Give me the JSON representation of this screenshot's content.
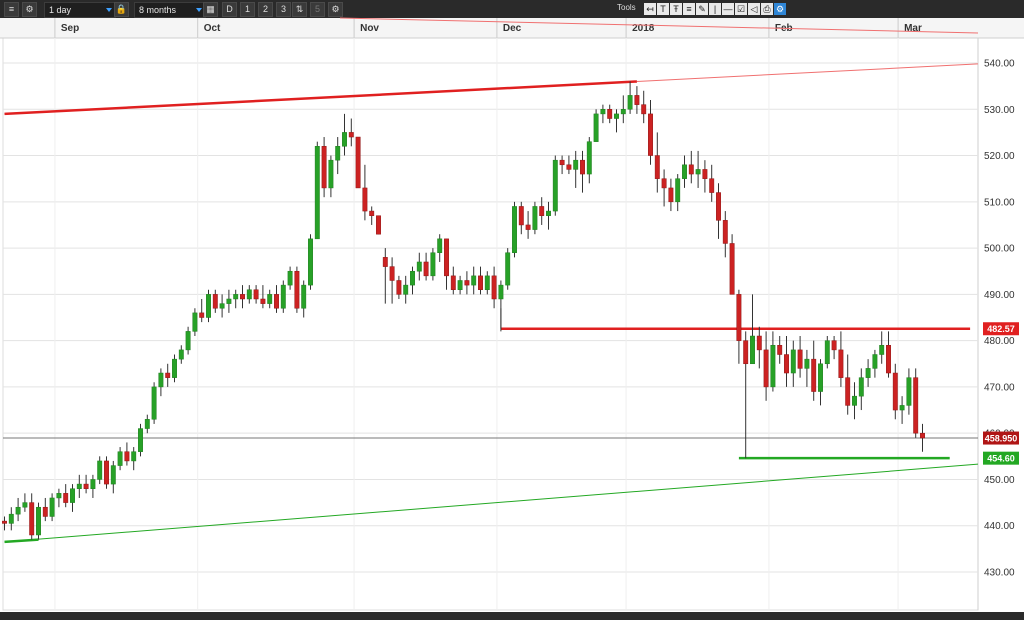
{
  "toolbar": {
    "interval": "1 day",
    "range": "8 months",
    "period_buttons": [
      "D",
      "1",
      "2",
      "3",
      "5"
    ],
    "tools_label": "Tools",
    "tool_icons": [
      "arrow-back-icon",
      "text-icon",
      "text-format-icon",
      "fibonacci-icon",
      "drawing-pen-icon",
      "vertical-line-icon",
      "horizontal-line-icon",
      "checkbox-icon",
      "shape-icon",
      "print-icon",
      "settings-icon"
    ]
  },
  "chart_data": {
    "type": "candlestick",
    "title": "",
    "xlabel": "",
    "ylabel": "",
    "ylim": [
      425,
      545
    ],
    "yticks": [
      "540.00",
      "530.00",
      "520.00",
      "510.00",
      "500.00",
      "490.00",
      "480.00",
      "470.00",
      "460.00",
      "450.00",
      "440.00",
      "430.00"
    ],
    "month_labels": [
      {
        "label": "Sep",
        "index": 8
      },
      {
        "label": "Oct",
        "index": 29
      },
      {
        "label": "Nov",
        "index": 52
      },
      {
        "label": "Dec",
        "index": 73
      },
      {
        "label": "2018",
        "index": 92
      },
      {
        "label": "Feb",
        "index": 113
      },
      {
        "label": "Mar",
        "index": 132
      }
    ],
    "candles": [
      [
        441,
        442,
        439,
        440.5
      ],
      [
        440.5,
        444,
        439,
        442.5
      ],
      [
        442.5,
        446,
        441,
        444
      ],
      [
        444,
        447,
        443,
        445
      ],
      [
        445,
        447,
        437,
        438
      ],
      [
        438,
        445,
        437,
        444
      ],
      [
        444,
        446,
        441,
        442
      ],
      [
        442,
        447,
        441,
        446
      ],
      [
        446,
        448,
        444,
        447
      ],
      [
        447,
        449,
        444,
        445
      ],
      [
        445,
        449,
        443,
        448
      ],
      [
        448,
        451,
        446,
        449
      ],
      [
        449,
        451,
        447,
        448
      ],
      [
        448,
        451,
        446,
        450
      ],
      [
        450,
        455,
        449,
        454
      ],
      [
        454,
        455,
        448,
        449
      ],
      [
        449,
        454,
        447,
        453
      ],
      [
        453,
        457,
        452,
        456
      ],
      [
        456,
        458,
        453,
        454
      ],
      [
        454,
        457,
        452,
        456
      ],
      [
        456,
        462,
        455,
        461
      ],
      [
        461,
        464,
        460,
        463
      ],
      [
        463,
        471,
        462,
        470
      ],
      [
        470,
        474,
        468,
        473
      ],
      [
        473,
        475,
        470,
        472
      ],
      [
        472,
        477,
        471,
        476
      ],
      [
        476,
        479,
        475,
        478
      ],
      [
        478,
        483,
        477,
        482
      ],
      [
        482,
        487,
        481,
        486
      ],
      [
        486,
        489,
        484,
        485
      ],
      [
        485,
        491,
        484,
        490
      ],
      [
        490,
        491,
        486,
        487
      ],
      [
        487,
        490,
        485,
        488
      ],
      [
        488,
        491,
        486,
        489
      ],
      [
        489,
        491,
        487,
        490
      ],
      [
        490,
        492,
        487,
        489
      ],
      [
        489,
        492,
        488,
        491
      ],
      [
        491,
        492,
        488,
        489
      ],
      [
        489,
        492,
        487,
        488
      ],
      [
        488,
        491,
        487,
        490
      ],
      [
        490,
        492,
        486,
        487
      ],
      [
        487,
        493,
        486,
        492
      ],
      [
        492,
        496,
        491,
        495
      ],
      [
        495,
        496,
        486,
        487
      ],
      [
        487,
        493,
        485,
        492
      ],
      [
        492,
        503,
        491,
        502
      ],
      [
        502,
        523,
        509,
        522
      ],
      [
        522,
        524,
        511,
        513
      ],
      [
        513,
        520,
        511,
        519
      ],
      [
        519,
        524,
        516,
        522
      ],
      [
        522,
        529,
        520,
        525
      ],
      [
        525,
        528,
        522,
        524
      ],
      [
        524,
        520,
        514,
        513
      ],
      [
        513,
        518,
        506,
        508
      ],
      [
        508,
        509,
        505,
        507
      ],
      [
        507,
        504,
        503,
        503
      ],
      [
        498,
        500,
        488,
        496
      ],
      [
        496,
        498,
        488,
        493
      ],
      [
        493,
        494,
        489,
        490
      ],
      [
        490,
        494,
        488,
        492
      ],
      [
        492,
        496,
        490,
        495
      ],
      [
        495,
        499,
        493,
        497
      ],
      [
        497,
        499,
        493,
        494
      ],
      [
        494,
        500,
        493,
        499
      ],
      [
        499,
        503,
        497,
        502
      ],
      [
        502,
        502,
        491,
        494
      ],
      [
        494,
        496,
        490,
        491
      ],
      [
        491,
        494,
        490,
        493
      ],
      [
        493,
        495,
        490,
        492
      ],
      [
        492,
        496,
        490,
        494
      ],
      [
        494,
        496,
        490,
        491
      ],
      [
        491,
        495,
        490,
        494
      ],
      [
        494,
        496,
        487,
        489
      ],
      [
        489,
        493,
        482,
        492
      ],
      [
        492,
        500,
        491,
        499
      ],
      [
        499,
        510,
        498,
        509
      ],
      [
        509,
        510,
        503,
        505
      ],
      [
        505,
        508,
        502,
        504
      ],
      [
        504,
        510,
        503,
        509
      ],
      [
        509,
        511,
        505,
        507
      ],
      [
        507,
        510,
        504,
        508
      ],
      [
        508,
        520,
        507,
        519
      ],
      [
        519,
        520,
        516,
        518
      ],
      [
        518,
        520,
        516,
        517
      ],
      [
        517,
        521,
        513,
        519
      ],
      [
        519,
        521,
        512,
        516
      ],
      [
        516,
        524,
        514,
        523
      ],
      [
        523,
        530,
        523,
        529
      ],
      [
        529,
        531,
        527,
        530
      ],
      [
        530,
        531,
        527,
        528
      ],
      [
        528,
        530,
        525,
        529
      ],
      [
        529,
        533,
        527,
        530
      ],
      [
        530,
        536,
        529,
        533
      ],
      [
        533,
        535,
        529,
        531
      ],
      [
        531,
        534,
        527,
        529
      ],
      [
        529,
        532,
        518,
        520
      ],
      [
        520,
        525,
        512,
        515
      ],
      [
        515,
        517,
        509,
        513
      ],
      [
        513,
        515,
        508,
        510
      ],
      [
        510,
        516,
        508,
        515
      ],
      [
        515,
        520,
        513,
        518
      ],
      [
        518,
        521,
        514,
        516
      ],
      [
        516,
        521,
        513,
        517
      ],
      [
        517,
        519,
        512,
        515
      ],
      [
        515,
        518,
        510,
        512
      ],
      [
        512,
        514,
        502,
        506
      ],
      [
        506,
        508,
        498,
        501
      ],
      [
        501,
        503,
        490,
        490
      ],
      [
        490,
        491,
        475,
        480
      ],
      [
        480,
        482,
        454.6,
        475
      ],
      [
        475,
        490,
        479,
        481
      ],
      [
        481,
        483,
        474,
        478
      ],
      [
        478,
        482,
        467,
        470
      ],
      [
        470,
        482,
        469,
        479
      ],
      [
        479,
        481,
        475,
        477
      ],
      [
        477,
        481,
        470,
        473
      ],
      [
        473,
        480,
        470,
        478
      ],
      [
        478,
        481,
        472,
        474
      ],
      [
        474,
        478,
        470,
        476
      ],
      [
        476,
        480,
        467,
        469
      ],
      [
        469,
        476,
        466,
        475
      ],
      [
        475,
        481,
        474,
        480
      ],
      [
        480,
        481,
        476,
        478
      ],
      [
        478,
        482,
        470,
        472
      ],
      [
        472,
        477,
        464,
        466
      ],
      [
        466,
        471,
        463,
        468
      ],
      [
        468,
        474,
        465,
        472
      ],
      [
        472,
        476,
        470,
        474
      ],
      [
        474,
        478,
        472,
        477
      ],
      [
        477,
        482,
        475,
        479
      ],
      [
        479,
        482,
        472,
        473
      ],
      [
        473,
        475,
        463,
        465
      ],
      [
        465,
        468,
        462,
        466
      ],
      [
        466,
        474,
        464,
        472
      ],
      [
        472,
        474,
        459,
        460
      ],
      [
        460,
        462,
        456,
        458.95
      ]
    ],
    "price_tags": [
      {
        "label": "482.57",
        "value": 482.57,
        "color": "#e02020"
      },
      {
        "label": "458.950",
        "value": 458.95,
        "color": "#b01515"
      },
      {
        "label": "454.60",
        "value": 454.6,
        "color": "#23a823"
      }
    ],
    "lines": [
      {
        "kind": "resistance-trendline",
        "color": "#e02020",
        "from": [
          0,
          529
        ],
        "to": [
          93,
          536
        ]
      },
      {
        "kind": "resistance-trendline-extension",
        "color": "#f07070",
        "from": [
          93,
          536
        ],
        "to": [
          142,
          539.8
        ]
      },
      {
        "kind": "support-trendline",
        "color": "#23a823",
        "from": [
          0,
          436.5
        ],
        "to": [
          142,
          453.3
        ]
      },
      {
        "kind": "support-trendline-anchor",
        "color": "#23a823",
        "from": [
          0,
          436.5
        ],
        "to": [
          5,
          437
        ]
      },
      {
        "kind": "horizontal-resistance",
        "color": "#e02020",
        "from": [
          73,
          482.57
        ],
        "to": [
          142,
          482.57
        ]
      },
      {
        "kind": "horizontal-support",
        "color": "#23a823",
        "from": [
          108,
          454.6
        ],
        "to": [
          139,
          454.6
        ]
      },
      {
        "kind": "current-price",
        "color": "#777777",
        "from": [
          0,
          458.95
        ],
        "to": [
          142,
          458.95
        ]
      },
      {
        "kind": "top-pink-diagonal",
        "color": "#f07070",
        "from": [
          51,
          0
        ],
        "to": [
          142,
          0
        ]
      }
    ],
    "colors": {
      "up": "#27a127",
      "down": "#cc2222",
      "grid": "#e3e3e3"
    },
    "grid": true
  }
}
